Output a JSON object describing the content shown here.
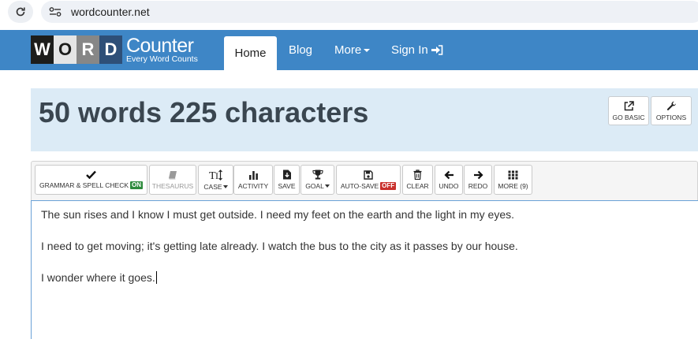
{
  "browser": {
    "url": "wordcounter.net"
  },
  "nav": {
    "logo_letters": [
      "W",
      "O",
      "R",
      "D"
    ],
    "logo_colors": [
      "#1d1d1b",
      "#e5e5e5",
      "#878787",
      "#2e4f78"
    ],
    "logo_counter": "Counter",
    "logo_tagline": "Every Word Counts",
    "items": {
      "home": "Home",
      "blog": "Blog",
      "more": "More",
      "signin": "Sign In"
    },
    "accent": "#3e86c6"
  },
  "header": {
    "count_title": "50 words 225 characters",
    "go_basic": "GO BASIC",
    "options": "OPTIONS"
  },
  "toolbar": {
    "grammar": "GRAMMAR & SPELL CHECK",
    "grammar_state": "ON",
    "thesaurus": "THESAURUS",
    "case": "CASE",
    "activity": "ACTIVITY",
    "save": "SAVE",
    "goal": "GOAL",
    "autosave": "AUTO-SAVE",
    "autosave_state": "OFF",
    "clear": "CLEAR",
    "undo": "UNDO",
    "redo": "REDO",
    "more": "MORE (9)"
  },
  "editor": {
    "paragraphs": [
      "The sun rises and I know I must get outside. I need my feet on the earth and the light in my eyes.",
      "I need to get moving; it's getting late already. I watch the bus to the city as it passes by our house.",
      "I wonder where it goes."
    ]
  }
}
